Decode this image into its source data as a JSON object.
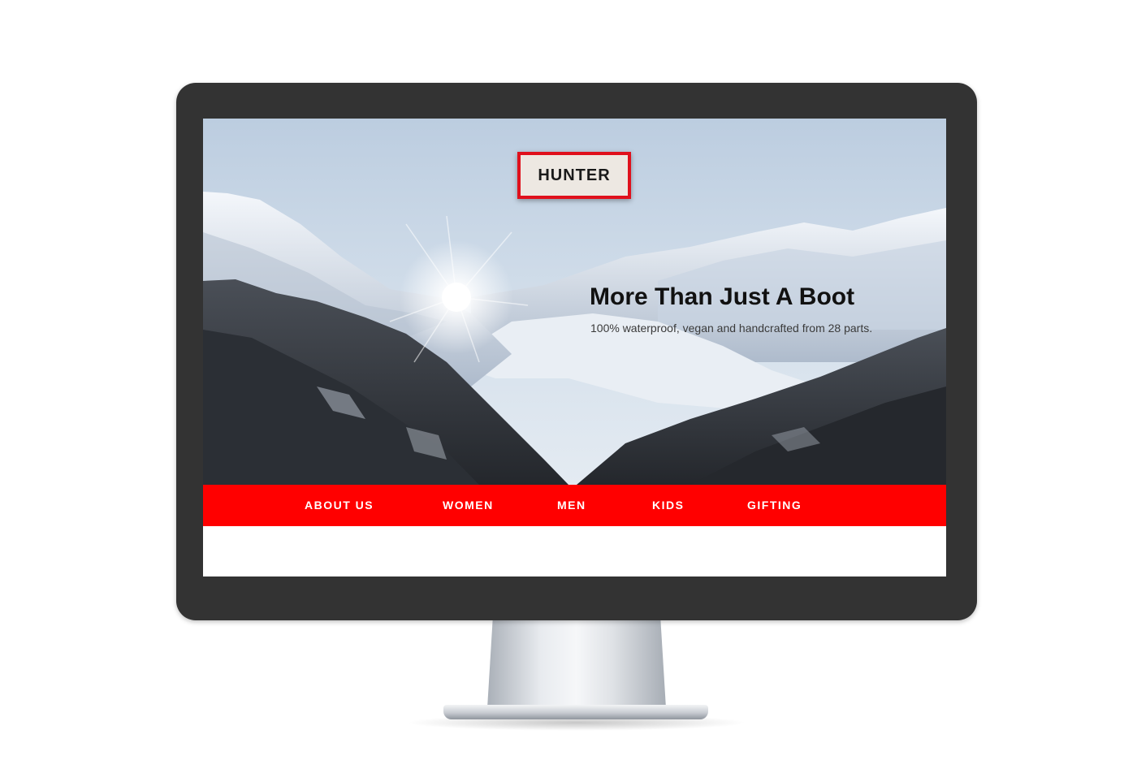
{
  "brand": {
    "logo_text": "HUNTER",
    "logo_border_color": "#e0101c"
  },
  "hero": {
    "headline": "More Than Just A Boot",
    "subheadline": "100% waterproof, vegan and handcrafted from 28 parts."
  },
  "nav": {
    "background_color": "#ff0000",
    "items": [
      {
        "label": "ABOUT US"
      },
      {
        "label": "WOMEN"
      },
      {
        "label": "MEN"
      },
      {
        "label": "KIDS"
      },
      {
        "label": "GIFTING"
      }
    ]
  }
}
